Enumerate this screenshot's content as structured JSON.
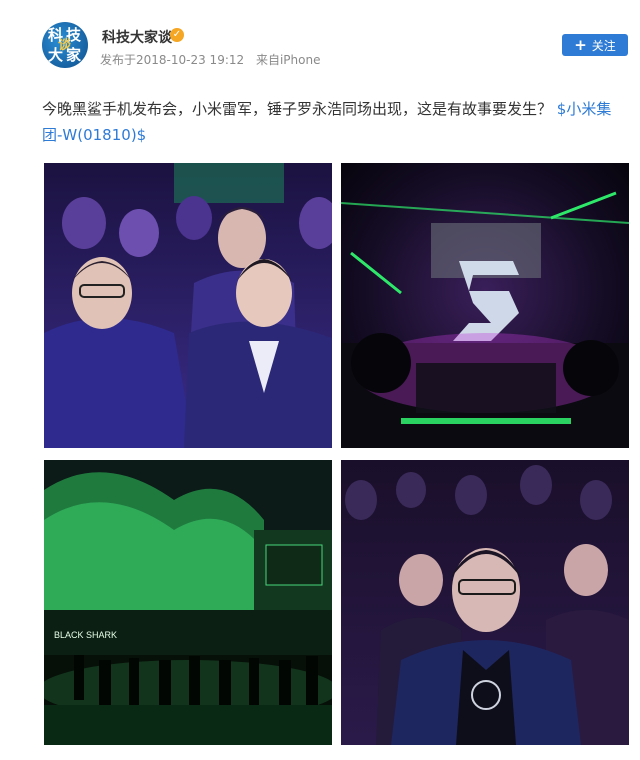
{
  "account": {
    "username": "科技大家谈",
    "avatar_text": [
      "科",
      "技",
      "大",
      "家",
      "谈"
    ],
    "verified_icon": "verified-badge-icon",
    "posted_at": "发布于2018-10-23 19:12",
    "source": "来自iPhone"
  },
  "follow_button": {
    "icon": "plus-icon",
    "label": "关注",
    "color": "#2e7bd6"
  },
  "post": {
    "text": "今晚黑鲨手机发布会，小米雷军，锤子罗永浩同场出现，这是有故事要发生？",
    "topic_link": "$小米集团-W(01810)$"
  },
  "photos": [
    {
      "name": "audience-front-row-photo",
      "sign_text": ""
    },
    {
      "name": "stage-s-logo-photo",
      "sign_text": ""
    },
    {
      "name": "venue-exterior-photo",
      "sign_text": "BLACK SHARK"
    },
    {
      "name": "audience-crowd-photo",
      "sign_text": ""
    }
  ],
  "colors": {
    "link": "#2e7bd6",
    "text": "#333333",
    "meta": "#8a8a8a"
  }
}
